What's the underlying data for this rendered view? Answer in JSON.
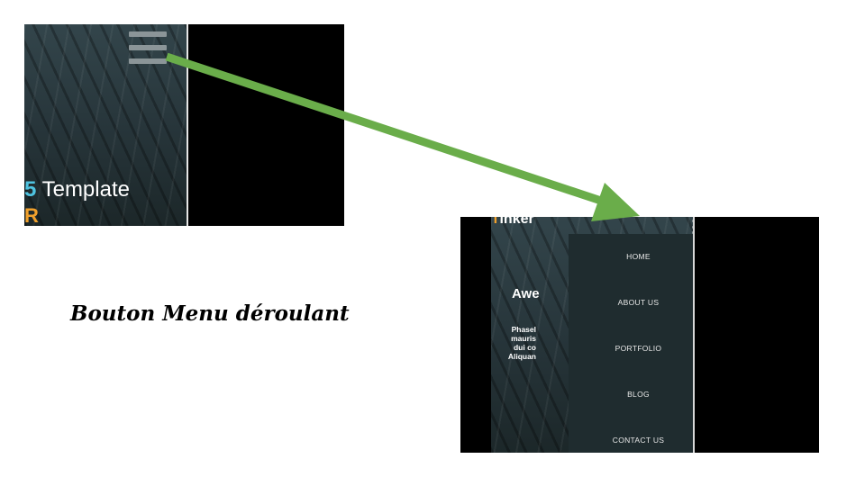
{
  "screenshot_before": {
    "hero_title_number": "5",
    "hero_title_text": "Template",
    "hero_subtitle": "R"
  },
  "screenshot_after": {
    "brand_first_letter": "T",
    "brand_rest": "inker",
    "heading": "Awe",
    "paragraph_lines": [
      "Phasel",
      "mauris",
      "dui co",
      "Aliquan"
    ],
    "menu_items": [
      "HOME",
      "ABOUT US",
      "PORTFOLIO",
      "BLOG",
      "CONTACT US"
    ]
  },
  "caption": "Bouton Menu déroulant",
  "colors": {
    "arrow": "#6aad4a",
    "accent_orange": "#f0a02c",
    "accent_cyan": "#4fc3e0",
    "menu_bg": "#1f2c2f"
  }
}
